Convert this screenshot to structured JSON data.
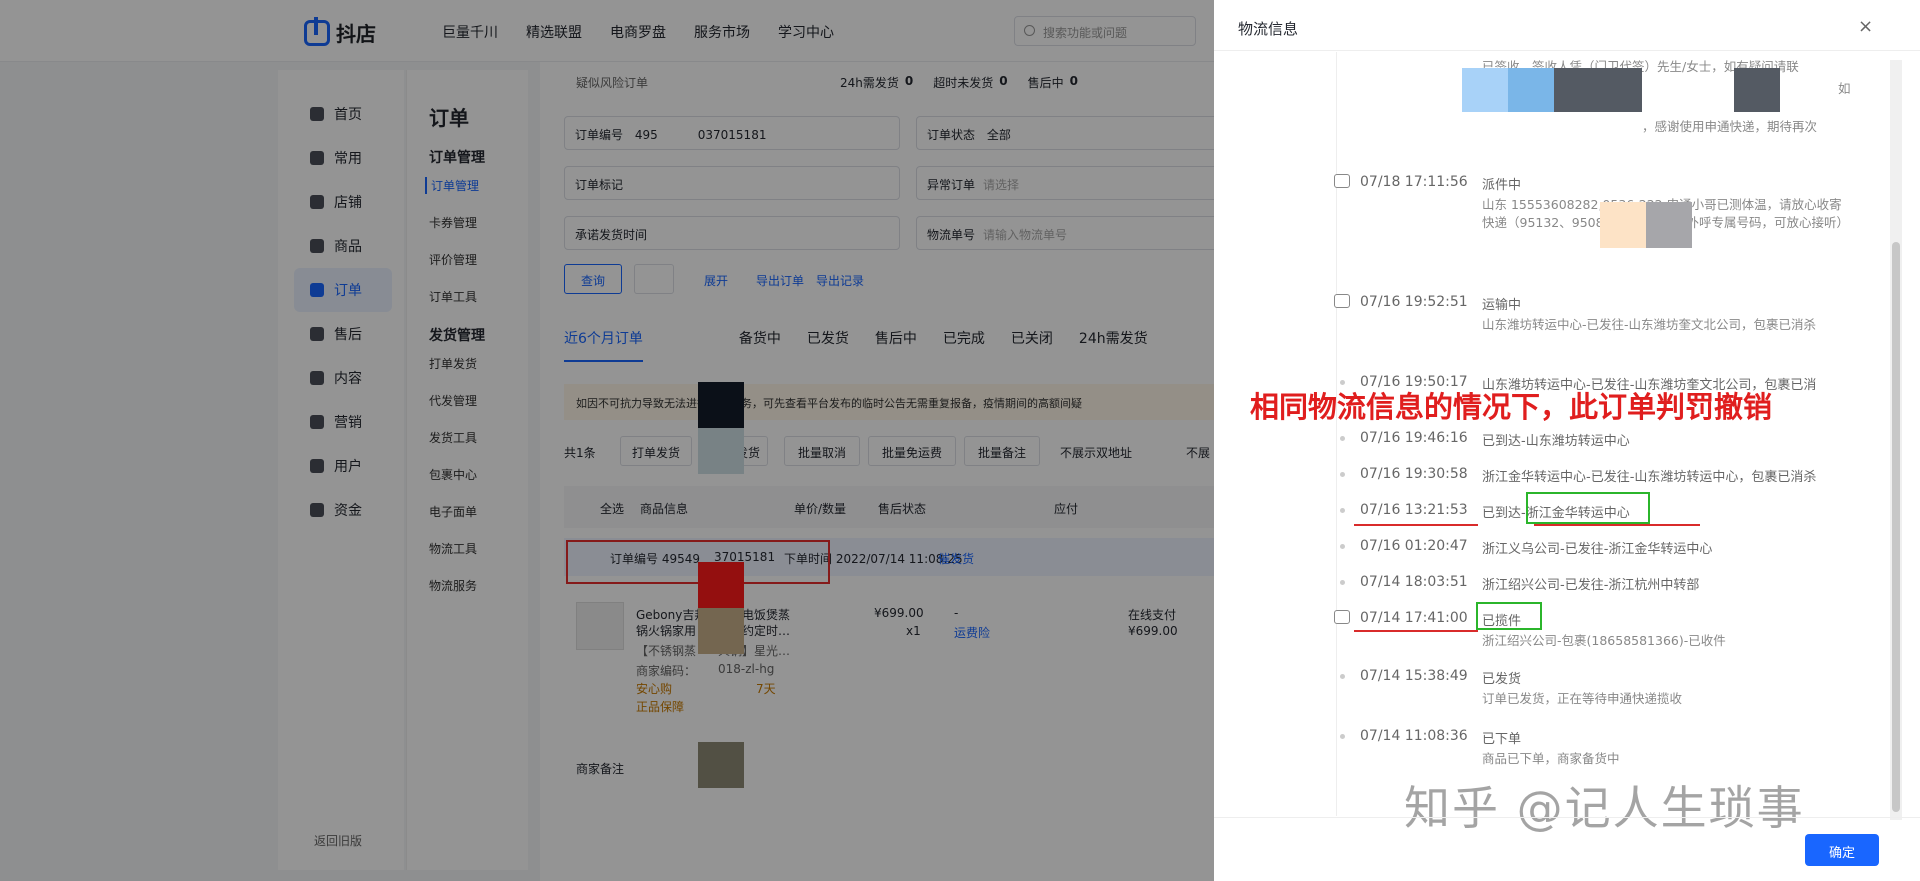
{
  "header": {
    "logo": "抖店",
    "nav": [
      "巨量千川",
      "精选联盟",
      "电商罗盘",
      "服务市场",
      "学习中心"
    ],
    "search_placeholder": "搜索功能或问题"
  },
  "sidebar": {
    "items": [
      "首页",
      "常用",
      "店铺",
      "商品",
      "订单",
      "售后",
      "内容",
      "营销",
      "用户",
      "资金"
    ],
    "active": "订单",
    "back": "返回旧版"
  },
  "subnav": {
    "title": "订单",
    "groups": [
      {
        "title": "订单管理",
        "links": [
          "订单管理",
          "卡券管理",
          "评价管理",
          "订单工具"
        ]
      },
      {
        "title": "发货管理",
        "links": [
          "打单发货",
          "代发管理",
          "发货工具",
          "包裹中心",
          "电子面单",
          "物流工具",
          "物流服务"
        ]
      }
    ]
  },
  "main": {
    "risk": "疑似风险订单",
    "stats": [
      "24h需发货",
      "0",
      "超时未发货",
      "0",
      "售后中",
      "0"
    ],
    "order_no_label": "订单编号",
    "order_no_value": "495",
    "order_no_value2": "037015181",
    "order_status_label": "订单状态",
    "order_status_value": "全部",
    "order_mark_label": "订单标记",
    "abnormal_label": "异常订单",
    "abnormal_ph": "请选择",
    "promise_label": "承诺发货时间",
    "logistics_label": "物流单号",
    "logistics_ph": "请输入物流单号",
    "query": "查询",
    "expand": "展开",
    "export": "导出订单",
    "export_log": "导出记录",
    "tabs": [
      "近6个月订单",
      "备货中",
      "已发货",
      "售后中",
      "已完成",
      "已关闭",
      "24h需发货"
    ],
    "warning": "如因不可抗力导致无法进行售后服务，可先查看平台发布的临时公告无需重复报备，疫情期间的高额间疑",
    "total": "共1条",
    "batch": [
      "打单发货",
      "发货",
      "批量取消",
      "批量免运费",
      "批量备注"
    ],
    "no_dup": "不展示双地址",
    "no_show": "不展",
    "cols": [
      "全选",
      "商品信息",
      "单价/数量",
      "售后状态",
      "应付"
    ],
    "order_line": {
      "label": "订单编号 49549",
      "no_tail": "37015181",
      "time": "下单时间 2022/07/14 11:08:25",
      "urge": "催发货"
    },
    "product": {
      "name1": "Gebony吉邦",
      "name2": "力锅电饭煲蒸",
      "name3": "锅火锅家用",
      "name4": "能预约定时…",
      "spec1": "【不锈钢蒸",
      "spec2": "火锅】星光…",
      "code": "商家编码：",
      "code2": "018-zl-hg",
      "badge1": "安心购",
      "badge2": "7天",
      "badge3": "正品保障",
      "price": "¥699.00",
      "qty": "x1",
      "after": "-",
      "freight": "运费险",
      "pay": "在线支付",
      "paid": "¥699.00"
    },
    "remark_label": "商家备注"
  },
  "drawer": {
    "title": "物流信息",
    "close": "×",
    "ok": "确定",
    "top_text": "已签收，签收人凭（门卫代签）先生/女士，如有疑问请联",
    "top_text2": "如",
    "top_text3": "，感谢使用申通快递，期待再次",
    "events": [
      {
        "time": "07/18 17:11:56",
        "status": "派件中",
        "desc": "山东                           15553608282,0536-222                              申通小哥已测体温，请放心收寄快递（95132、95089为申通业务员外呼专属号码，可放心接听）"
      },
      {
        "time": "07/16 19:52:51",
        "status": "运输中",
        "desc": "山东潍坊转运中心-已发往-山东潍坊奎文北公司，包裹已消杀"
      },
      {
        "time": "07/16 19:50:17",
        "status": "山东潍坊转运中心-已发往-山东潍坊奎文北公司，包裹已消",
        "desc": ""
      },
      {
        "time": "07/16 19:46:16",
        "status": "已到达-山东潍坊转运中心",
        "desc": ""
      },
      {
        "time": "07/16 19:30:58",
        "status": "浙江金华转运中心-已发往-山东潍坊转运中心，包裹已消杀",
        "desc": ""
      },
      {
        "time": "07/16 13:21:53",
        "status": "已到达-浙江金华转运中心",
        "desc": ""
      },
      {
        "time": "07/16 01:20:47",
        "status": "浙江义乌公司-已发往-浙江金华转运中心",
        "desc": ""
      },
      {
        "time": "07/14 18:03:51",
        "status": "浙江绍兴公司-已发往-浙江杭州中转部",
        "desc": ""
      },
      {
        "time": "07/14 17:41:00",
        "status": "已揽件",
        "desc": "浙江绍兴公司-包裹(18658581366)-已收件"
      },
      {
        "time": "07/14 15:38:49",
        "status": "已发货",
        "desc": "订单已发货，正在等待申通快递揽收"
      },
      {
        "time": "07/14 11:08:36",
        "status": "已下单",
        "desc": "商品已下单，商家备货中"
      }
    ],
    "annotation": "相同物流信息的情况下，此订单判罚撤销",
    "watermark": "知乎 @记人生琐事"
  },
  "colors": {
    "accent": "#1966ff",
    "annotation_red": "#e01e1e",
    "highlight_green": "#2bb52b"
  }
}
